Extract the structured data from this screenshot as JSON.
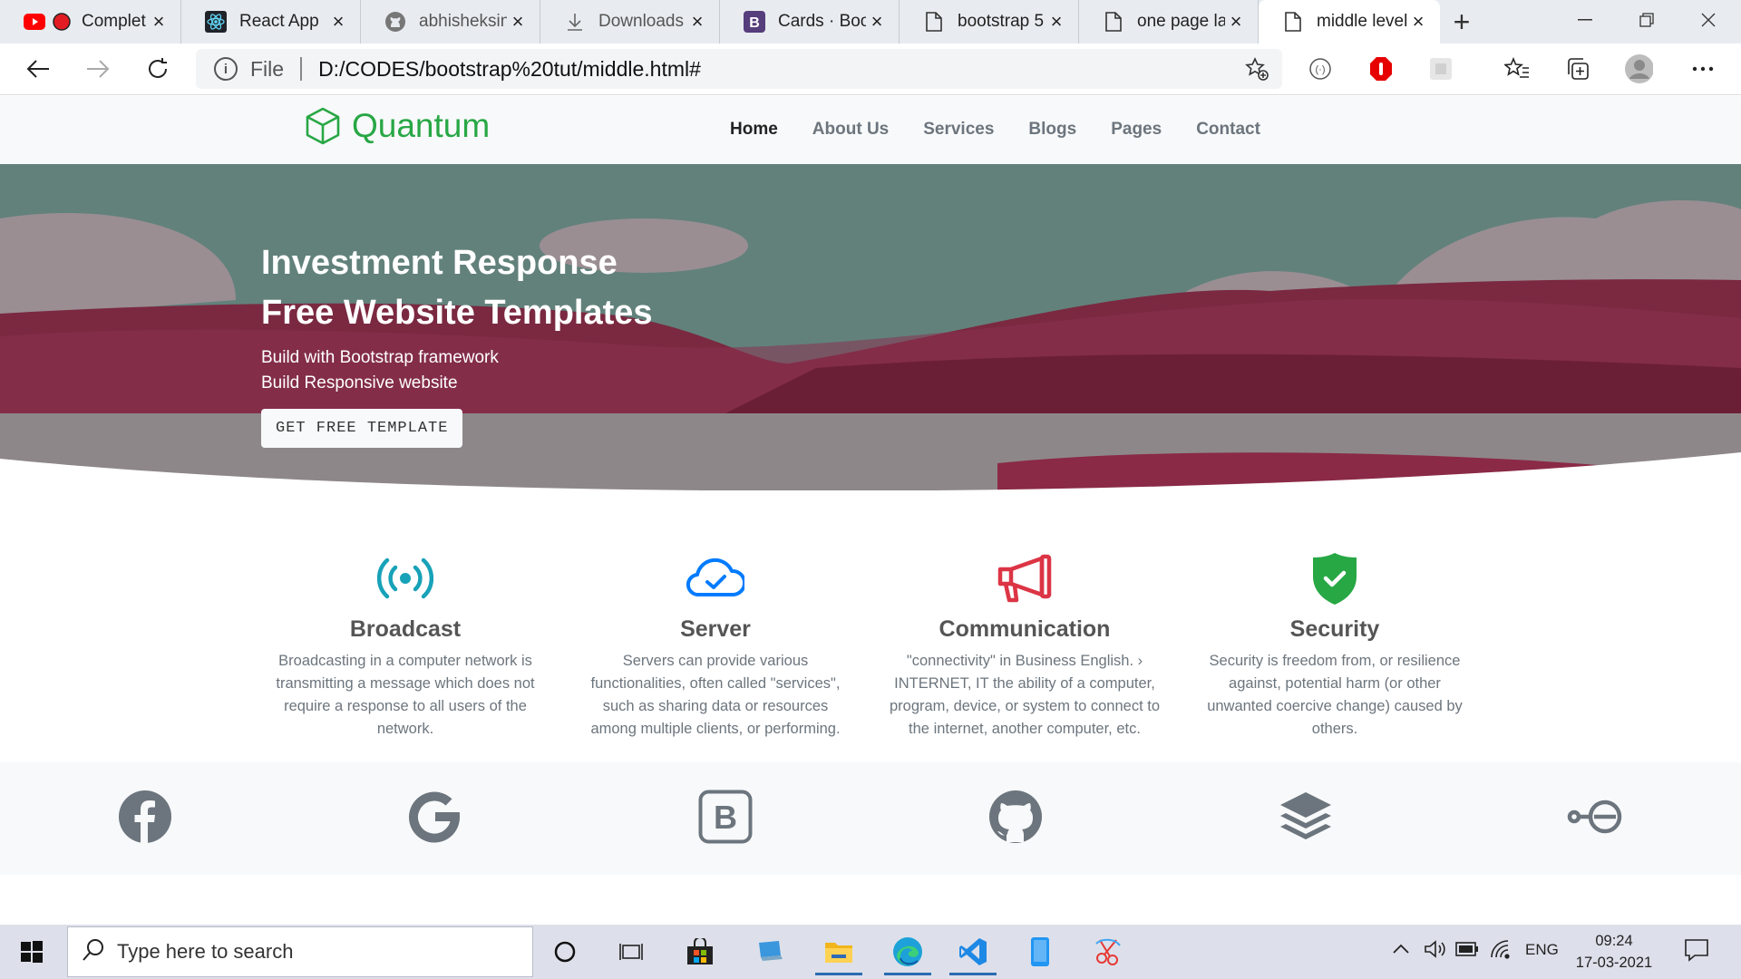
{
  "browser": {
    "tabs": [
      {
        "title": "Complet",
        "icon": "youtube-icon"
      },
      {
        "title": "React App",
        "icon": "react-icon"
      },
      {
        "title": "abhisheksin",
        "icon": "github-icon"
      },
      {
        "title": "Downloads",
        "icon": "download-icon"
      },
      {
        "title": "Cards · Boot",
        "icon": "bootstrap-icon"
      },
      {
        "title": "bootstrap 5",
        "icon": "file-icon"
      },
      {
        "title": "one page la",
        "icon": "file-icon"
      },
      {
        "title": "middle level",
        "icon": "file-icon",
        "active": true
      }
    ],
    "new_tab_label": "+",
    "address": {
      "scheme_label": "File",
      "url": "D:/CODES/bootstrap%20tut/middle.html#"
    }
  },
  "site": {
    "brand": "Quantum",
    "brand_color": "#28a745",
    "nav": [
      {
        "label": "Home",
        "active": true
      },
      {
        "label": "About Us"
      },
      {
        "label": "Services"
      },
      {
        "label": "Blogs"
      },
      {
        "label": "Pages"
      },
      {
        "label": "Contact"
      }
    ],
    "hero": {
      "title_line1": "Investment Response",
      "title_line2": "Free Website Templates",
      "subtitle_line1": "Build with Bootstrap framework",
      "subtitle_line2": "Build Responsive website",
      "button": "GET FREE TEMPLATE"
    },
    "features": [
      {
        "icon": "broadcast-icon",
        "title": "Broadcast",
        "color": "#17a2b8",
        "text": "Broadcasting in a computer network is transmitting a message which does not require a response to all users of the network."
      },
      {
        "icon": "cloud-check-icon",
        "title": "Server",
        "color": "#007bff",
        "text": "Servers can provide various functionalities, often called \"services\", such as sharing data or resources among multiple clients, or performing."
      },
      {
        "icon": "megaphone-icon",
        "title": "Communication",
        "color": "#dc3545",
        "text": "\"connectivity\" in Business English. › INTERNET, IT the ability of a computer, program, device, or system to connect to the internet, another computer, etc."
      },
      {
        "icon": "shield-check-icon",
        "title": "Security",
        "color": "#28a745",
        "text": "Security is freedom from, or resilience against, potential harm (or other unwanted coercive change) caused by others."
      }
    ],
    "social_icons": [
      "facebook-icon",
      "google-icon",
      "bootstrap-icon",
      "github-icon",
      "layers-icon",
      "key-icon"
    ]
  },
  "taskbar": {
    "search_placeholder": "Type here to search",
    "language": "ENG",
    "time": "09:24",
    "date": "17-03-2021"
  }
}
